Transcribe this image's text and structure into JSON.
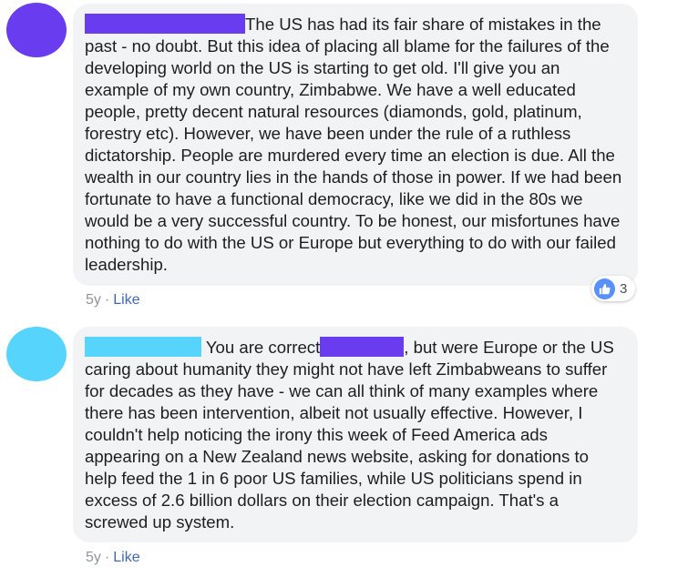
{
  "colors": {
    "avatar_1": "#6a3cf0",
    "avatar_2": "#56d4fc",
    "redact_author_1": "#6a3cf0",
    "redact_author_2": "#56d4fc",
    "redact_mention": "#6a3cf0",
    "bubble_bg": "#f2f3f5",
    "link": "#4267b2",
    "like_badge": "#5890ff"
  },
  "comments": [
    {
      "author_name_hidden": true,
      "text": "The US has had its fair share of mistakes in the past - no doubt. But this idea of placing all blame for the failures of the developing world on the US is starting to get old. I'll give you an example of my own country, Zimbabwe. We have a well educated people, pretty decent natural resources (diamonds, gold, platinum, forestry etc). However, we have been under the rule of a ruthless dictatorship. People are murdered every time an election is due. All the wealth in our country lies in the hands of those in power. If we had been fortunate to have a functional democracy, like we did in the 80s we would be a very successful country. To be honest, our misfortunes have nothing to do with the US or Europe but everything to do with our failed leadership.",
      "time": "5y",
      "separator": "·",
      "like_label": "Like",
      "reactions": {
        "icon": "thumbs-up-icon",
        "count": "3"
      }
    },
    {
      "author_name_hidden": true,
      "text_before_mention": "You are correct",
      "text_after_mention": ", but were Europe or the US caring about humanity they might not have left Zimbabweans to suffer for decades as they have - we can all think of many examples where there has been intervention, albeit not usually effective. However, I couldn't help noticing the irony this week of Feed America ads appearing on a New Zealand news website, asking for donations to help feed the 1 in 6 poor US families, while US politicians spend in excess of 2.6 billion dollars on their election campaign. That's a screwed up system.",
      "time": "5y",
      "separator": "·",
      "like_label": "Like"
    }
  ]
}
